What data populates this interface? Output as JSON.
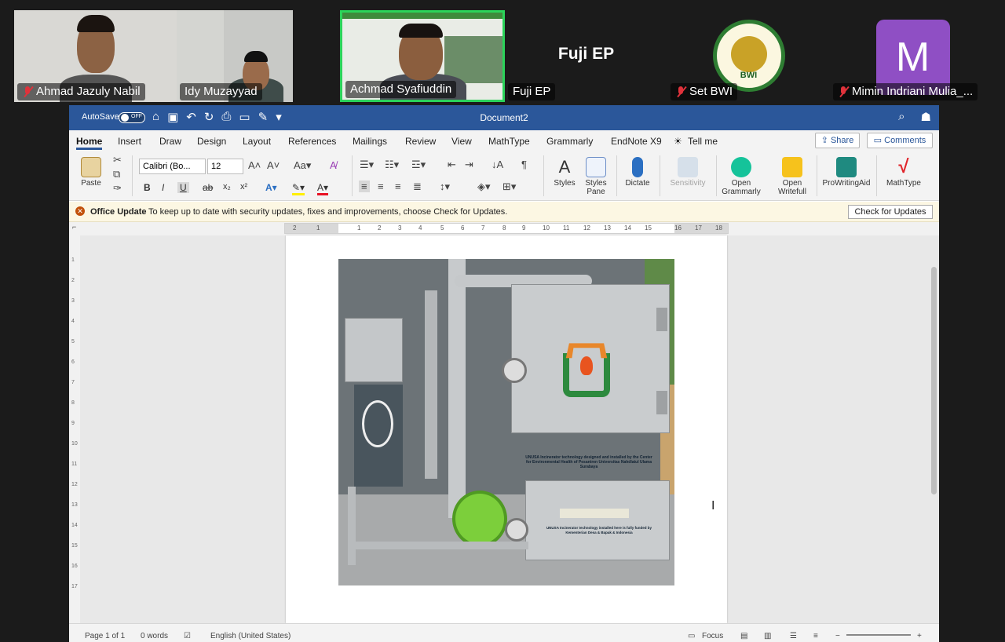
{
  "participants": [
    {
      "name": "Ahmad Jazuly Nabil",
      "muted": true
    },
    {
      "name": "Idy Muzayyad",
      "muted": false
    },
    {
      "name": "Achmad Syafiuddin",
      "muted": false,
      "active_speaker": true
    },
    {
      "name": "Fuji EP",
      "muted": false,
      "center_text": "Fuji EP"
    },
    {
      "name": "Set BWI",
      "muted": true,
      "logo_text": "BWI"
    },
    {
      "name": "Mimin Indriani Mulia_...",
      "muted": true,
      "avatar_letter": "M"
    }
  ],
  "word": {
    "autosave_label": "AutoSave",
    "autosave_state": "OFF",
    "doc_title": "Document2",
    "tabs": [
      "Home",
      "Insert",
      "Draw",
      "Design",
      "Layout",
      "References",
      "Mailings",
      "Review",
      "View",
      "MathType",
      "Grammarly",
      "EndNote X9",
      "Tell me"
    ],
    "share_label": "Share",
    "comments_label": "Comments",
    "ribbon": {
      "paste": "Paste",
      "font_name": "Calibri (Bo...",
      "font_size": "12",
      "styles": "Styles",
      "styles_pane": "Styles Pane",
      "dictate": "Dictate",
      "sensitivity": "Sensitivity",
      "open_grammarly": "Open Grammarly",
      "open_writefull": "Open Writefull",
      "prowritingaid": "ProWritingAid",
      "mathtype": "MathType"
    },
    "office_update": {
      "title": "Office Update",
      "message": "To keep up to date with security updates, fixes and improvements, choose Check for Updates.",
      "button": "Check for Updates"
    },
    "ruler_numbers": [
      "2",
      "1",
      "1",
      "2",
      "3",
      "4",
      "5",
      "6",
      "7",
      "8",
      "9",
      "10",
      "11",
      "12",
      "13",
      "14",
      "15",
      "16",
      "17",
      "18"
    ],
    "vruler_numbers": [
      "1",
      "2",
      "3",
      "4",
      "5",
      "6",
      "7",
      "8",
      "9",
      "10",
      "11",
      "12",
      "13",
      "14",
      "15",
      "16",
      "17"
    ],
    "photo_caption_1": "UNUSA Incinerator technology designed and installed by the Center for Environmental Health of Pesantren Universitas Nahdlatul Ulama Surabaya",
    "photo_caption_2": "UNUSA Incinerator technology installed here is fully funded by Kementerian Desa & Bapak & Indonesia",
    "status": {
      "page": "Page 1 of 1",
      "words": "0 words",
      "language": "English (United States)",
      "focus": "Focus"
    }
  }
}
